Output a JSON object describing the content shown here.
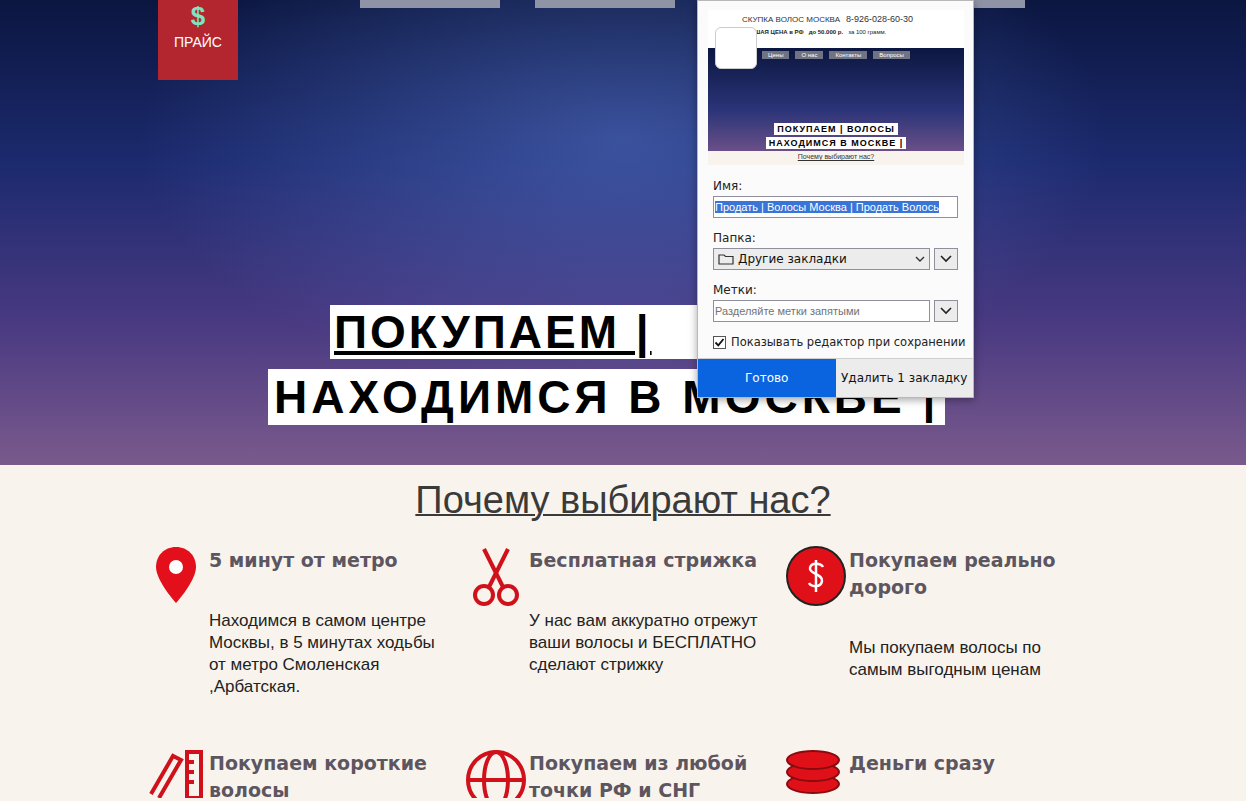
{
  "price_button": {
    "icon": "$",
    "label": "ПРАЙС"
  },
  "hero": {
    "lines": [
      "ПОКУПАЕМ |",
      "НАХОДИМСЯ В МОСКВЕ |"
    ]
  },
  "bookmark_dialog": {
    "preview": {
      "header": "СКУПКА ВОЛОС МОСКВА",
      "phone": "8-926-028-60-30",
      "tagline": "ЛУЧШАЯ ЦЕНА в РФ",
      "price": "до 50.000 р.",
      "price_note": "за 100 грамм.",
      "nav": [
        "Цены",
        "О нас",
        "Контакты",
        "Вопросы"
      ],
      "headline": [
        "ПОКУПАЕМ | ВОЛОСЫ",
        "НАХОДИМСЯ В МОСКВЕ |"
      ],
      "subheading": "Почему выбирают нас?"
    },
    "name": {
      "label": "Имя:",
      "value": "Продать | Волосы Москва | Продать Волось",
      "selected": true
    },
    "folder": {
      "label": "Папка:",
      "value": "Другие закладки"
    },
    "tags": {
      "label": "Метки:",
      "placeholder": "Разделяйте метки запятыми"
    },
    "show_editor": {
      "label": "Показывать редактор при сохранении",
      "checked": true
    },
    "buttons": [
      {
        "label": "Готово",
        "primary": true
      },
      {
        "label": "Удалить 1 закладку",
        "primary": false
      }
    ]
  },
  "section_title": "Почему выбирают нас?",
  "features": [
    {
      "title": "5 минут от метро",
      "text": "Находимся в самом центре Москвы, в 5 минутах ходьбы от метро Смоленская ,Арбатская."
    },
    {
      "title": "Бесплатная стрижка",
      "text": "У нас вам аккуратно отрежут ваши волосы и БЕСПЛАТНО сделают стрижку"
    },
    {
      "title": "Покупаем реально дорого",
      "text": "Мы покупаем волосы по самым выгодным ценам"
    },
    {
      "title": "Покупаем короткие волосы"
    },
    {
      "title": "Покупаем из любой точки РФ и СНГ"
    },
    {
      "title": "Деньги сразу"
    }
  ]
}
